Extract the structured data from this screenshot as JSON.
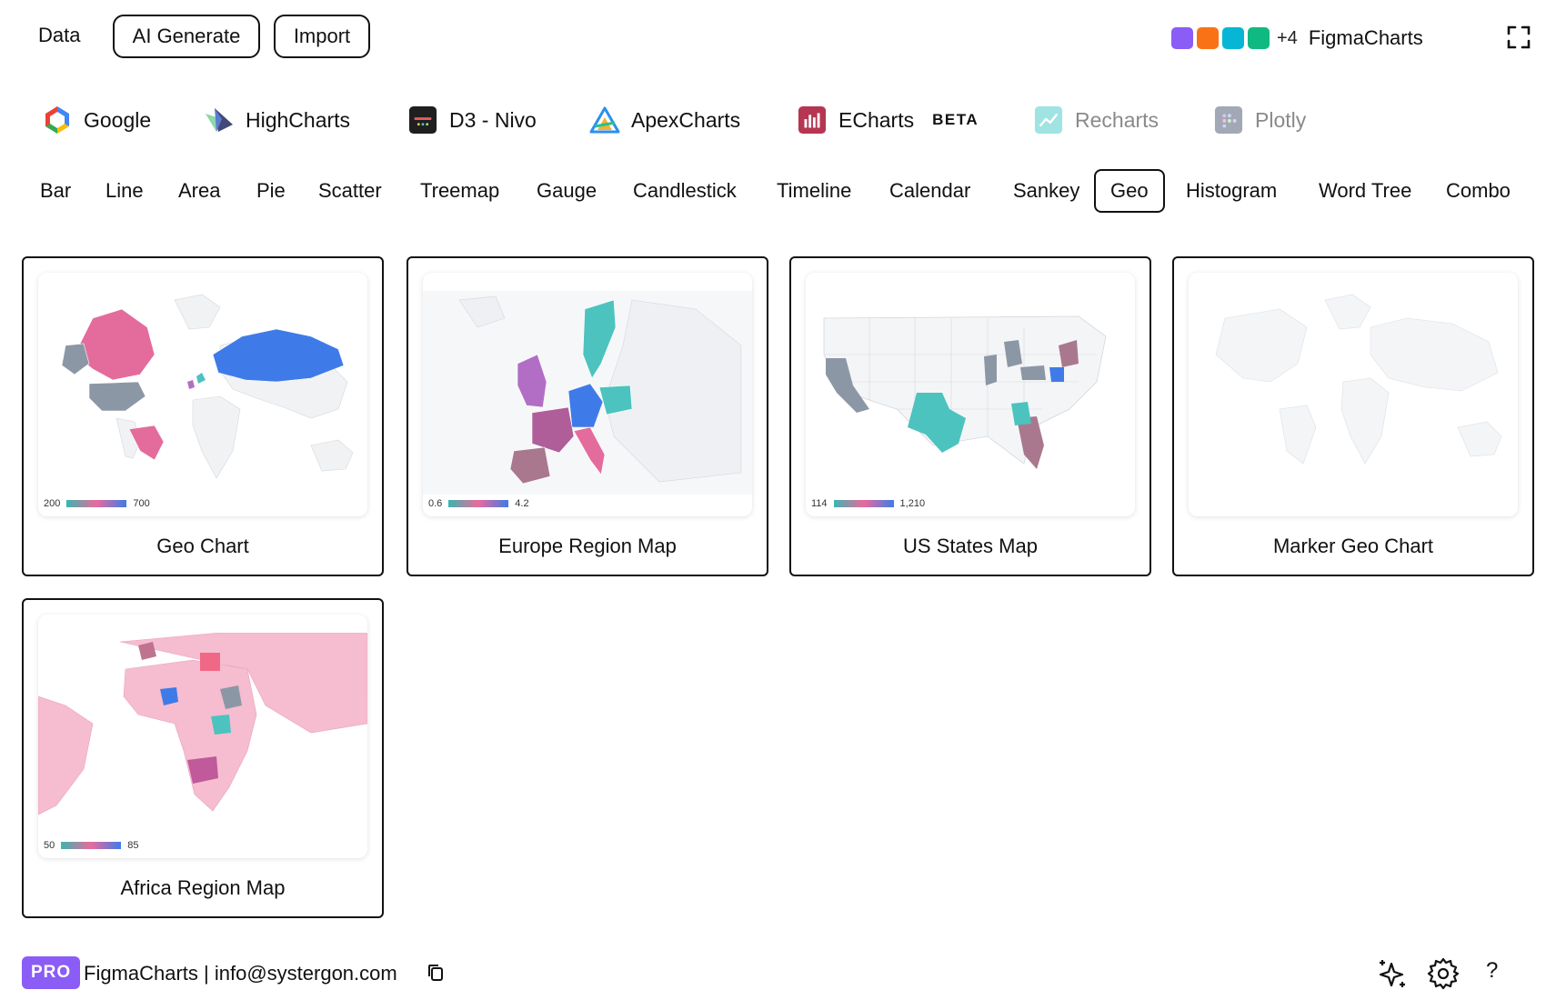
{
  "topbar": {
    "data_label": "Data",
    "ai_generate_label": "AI Generate",
    "import_label": "Import",
    "presence_colors": [
      "#8b5cf6",
      "#f97316",
      "#06b6d4",
      "#10b981"
    ],
    "presence_more": "+4",
    "brand": "FigmaCharts",
    "expand_icon": "expand-icon"
  },
  "libraries": [
    {
      "label": "Google",
      "icon": "google-logo-icon",
      "dim": false
    },
    {
      "label": "HighCharts",
      "icon": "highcharts-logo-icon",
      "dim": false
    },
    {
      "label": "D3 - Nivo",
      "icon": "nivo-logo-icon",
      "dim": false
    },
    {
      "label": "ApexCharts",
      "icon": "apexcharts-logo-icon",
      "dim": false
    },
    {
      "label": "ECharts",
      "icon": "echarts-logo-icon",
      "dim": false,
      "badge": "BETA"
    },
    {
      "label": "Recharts",
      "icon": "recharts-logo-icon",
      "dim": true
    },
    {
      "label": "Plotly",
      "icon": "plotly-logo-icon",
      "dim": true
    }
  ],
  "tabs": [
    {
      "label": "Bar"
    },
    {
      "label": "Line"
    },
    {
      "label": "Area"
    },
    {
      "label": "Pie"
    },
    {
      "label": "Scatter"
    },
    {
      "label": "Treemap"
    },
    {
      "label": "Gauge"
    },
    {
      "label": "Candlestick"
    },
    {
      "label": "Timeline"
    },
    {
      "label": "Calendar"
    },
    {
      "label": "Sankey"
    },
    {
      "label": "Geo",
      "active": true
    },
    {
      "label": "Histogram"
    },
    {
      "label": "Word Tree"
    },
    {
      "label": "Combo"
    }
  ],
  "cards": [
    {
      "title": "Geo Chart",
      "legend_min": "200",
      "legend_max": "700"
    },
    {
      "title": "Europe Region Map",
      "legend_min": "0.6",
      "legend_max": "4.2"
    },
    {
      "title": "US States Map",
      "legend_min": "114",
      "legend_max": "1,210"
    },
    {
      "title": "Marker Geo Chart"
    },
    {
      "title": "Africa Region Map",
      "legend_min": "50",
      "legend_max": "85"
    }
  ],
  "colors": {
    "teal": "#4cc3be",
    "pink": "#e36c9c",
    "blue": "#3f7be8",
    "gray": "#8c97a6",
    "mauve": "#a9788f",
    "light_pink": "#f6bcd0",
    "purple": "#b26ec4"
  },
  "footer": {
    "pro_badge": "PRO",
    "text": "FigmaCharts | info@systergon.com",
    "icons": [
      "sparkles-icon",
      "gear-icon",
      "help-icon"
    ],
    "help_label": "?"
  }
}
